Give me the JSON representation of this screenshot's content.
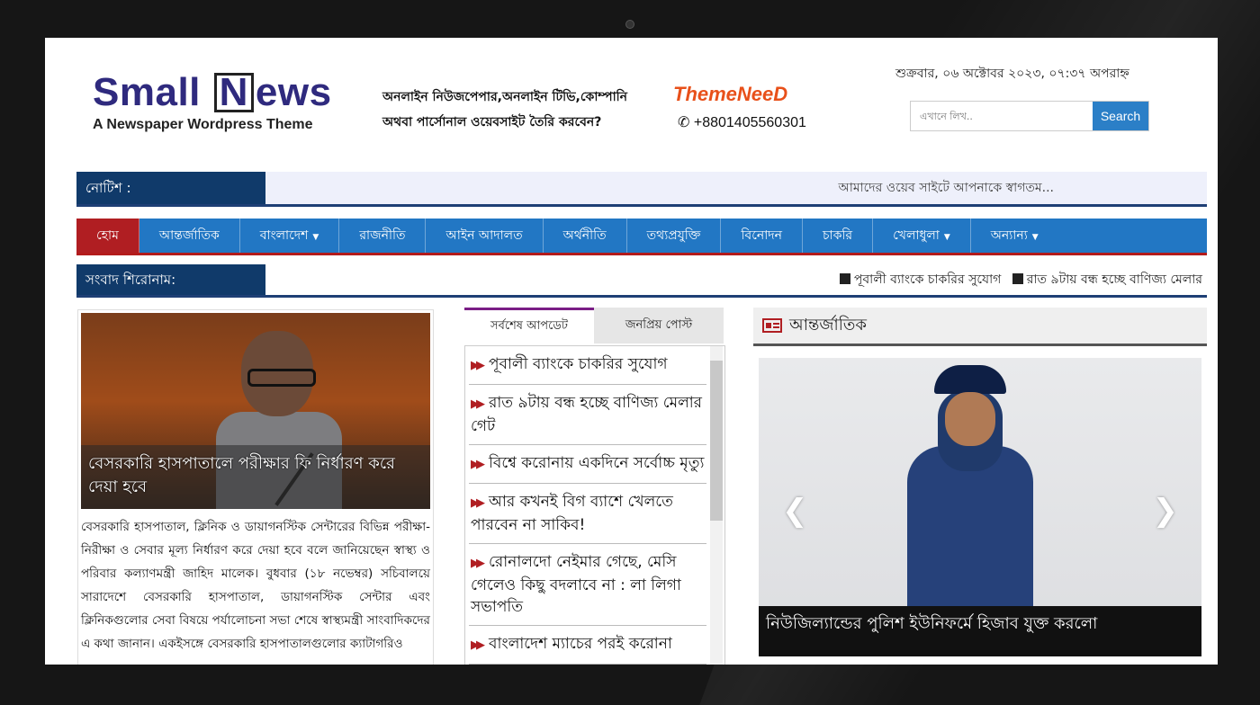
{
  "header": {
    "logo_title_before": "Small ",
    "logo_title_n": "N",
    "logo_title_after": "ews",
    "logo_subtitle": "A Newspaper Wordpress Theme",
    "ad_line1": "অনলাইন নিউজপেপার,অনলাইন টিভি,কোম্পানি",
    "ad_line2": "অথবা পার্সোনাল ওয়েবসাইট তৈরি করবেন?",
    "ad_brand": "ThemeNeeD",
    "ad_phone": "+8801405560301",
    "date": "শুক্রবার, ০৬ অক্টোবর ২০২৩, ০৭:৩৭ অপরাহ্ন",
    "search_placeholder": "এখানে লিখ..",
    "search_button": "Search"
  },
  "notice": {
    "label": "নোটিশ :",
    "text": "আমাদের ওয়েব সাইটে আপনাকে স্বাগতম..."
  },
  "nav": [
    {
      "label": "হোম",
      "dropdown": false
    },
    {
      "label": "আন্তর্জাতিক",
      "dropdown": false
    },
    {
      "label": "বাংলাদেশ",
      "dropdown": true
    },
    {
      "label": "রাজনীতি",
      "dropdown": false
    },
    {
      "label": "আইন আদালত",
      "dropdown": false
    },
    {
      "label": "অর্থনীতি",
      "dropdown": false
    },
    {
      "label": "তথ্যপ্রযুক্তি",
      "dropdown": false
    },
    {
      "label": "বিনোদন",
      "dropdown": false
    },
    {
      "label": "চাকরি",
      "dropdown": false
    },
    {
      "label": "খেলাধুলা",
      "dropdown": true
    },
    {
      "label": "অন্যান্য",
      "dropdown": true
    }
  ],
  "ticker": {
    "label": "সংবাদ শিরোনাম:",
    "items": [
      "পূবালী ব্যাংকে চাকরির সুযোগ",
      "রাত ৯টায় বন্ধ হচ্ছে বাণিজ্য মেলার"
    ]
  },
  "lead": {
    "headline": "বেসরকারি হাসপাতালে পরীক্ষার ফি নির্ধারণ করে দেয়া হবে",
    "body": "বেসরকারি হাসপাতাল, ক্লিনিক ও ডায়াগনস্টিক সেন্টারের বিভিন্ন পরীক্ষা-নিরীক্ষা ও সেবার মূল্য নির্ধারণ করে দেয়া হবে বলে জানিয়েছেন স্বাস্থ্য ও পরিবার কল্যাণমন্ত্রী জাহিদ মালেক। বুধবার (১৮ নভেম্বর) সচিবালয়ে সারাদেশে বেসরকারি হাসপাতাল, ডায়াগনস্টিক সেন্টার এবং ক্লিনিকগুলোর সেবা বিষয়ে পর্যালোচনা সভা শেষে স্বাস্থ্যমন্ত্রী সাংবাদিকদের এ কথা জানান। একইসঙ্গে বেসরকারি হাসপাতালগুলোর ক্যাটাগরিও"
  },
  "tabs": {
    "latest": "সর্বশেষ আপডেট",
    "popular": "জনপ্রিয় পোস্ট",
    "items": [
      "পূবালী ব্যাংকে চাকরির সুযোগ",
      "রাত ৯টায় বন্ধ হচ্ছে বাণিজ্য মেলার গেট",
      "বিশ্বে করোনায় একদিনে সর্বোচ্চ মৃত্যু",
      "আর কখনই বিগ ব্যাশে খেলতে পারবেন না সাকিব!",
      "রোনালদো নেইমার গেছে, মেসি গেলেও কিছু বদলাবে না : লা লিগা সভাপতি",
      "বাংলাদেশ ম্যাচের পরই করোনা"
    ]
  },
  "international": {
    "title": "আন্তর্জাতিক",
    "slide_caption": "নিউজিল্যান্ডের পুলিশ ইউনিফর্মে হিজাব যুক্ত করলো"
  },
  "colors": {
    "nav_bg": "#2277c4",
    "nav_active": "#b01e22",
    "label_bg": "#103a6a",
    "logo": "#2f2a7e",
    "search_button": "#2b7fc7"
  }
}
